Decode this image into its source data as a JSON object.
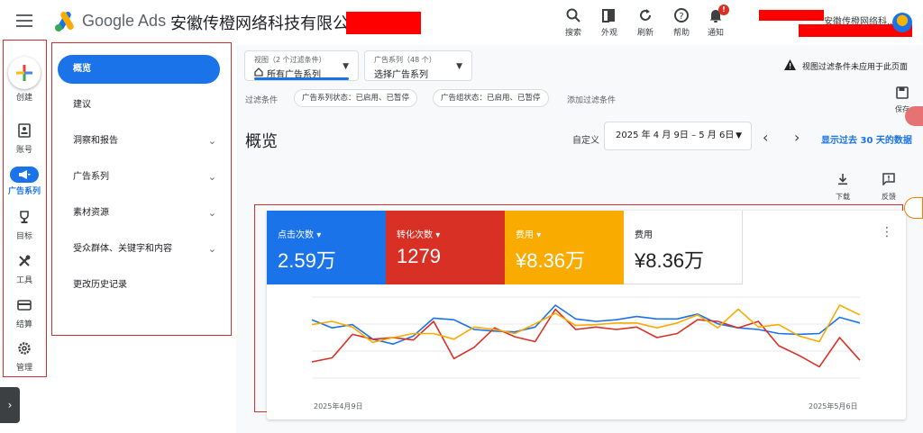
{
  "header": {
    "brand": "Google Ads",
    "company": "安徽传橙网络科技有限公司",
    "account_name": "安徽传橙网络科...",
    "buttons": [
      {
        "label": "搜索",
        "icon": "search-icon"
      },
      {
        "label": "外观",
        "icon": "appearance-icon"
      },
      {
        "label": "刷新",
        "icon": "refresh-icon"
      },
      {
        "label": "帮助",
        "icon": "help-icon"
      },
      {
        "label": "通知",
        "icon": "bell-icon"
      }
    ],
    "notification_badge": "!"
  },
  "rail": {
    "items": [
      {
        "label": "创建",
        "icon": "plus-icon"
      },
      {
        "label": "账号",
        "icon": "account-icon"
      },
      {
        "label": "广告系列",
        "icon": "megaphone-icon"
      },
      {
        "label": "目标",
        "icon": "trophy-icon"
      },
      {
        "label": "工具",
        "icon": "tools-icon"
      },
      {
        "label": "结算",
        "icon": "billing-card-icon"
      },
      {
        "label": "管理",
        "icon": "gear-icon"
      }
    ]
  },
  "nav": {
    "items": [
      {
        "label": "概览"
      },
      {
        "label": "建议"
      },
      {
        "label": "洞察和报告"
      },
      {
        "label": "广告系列"
      },
      {
        "label": "素材资源"
      },
      {
        "label": "受众群体、关键字和内容"
      },
      {
        "label": "更改历史记录"
      }
    ]
  },
  "toolbar": {
    "view_small": "视图（2 个过滤条件）",
    "view_value": "所有广告系列",
    "campaign_small": "广告系列（48 个）",
    "campaign_value": "选择广告系列",
    "warning": "视图过滤条件未应用于此页面",
    "filter_label": "过滤条件",
    "chips": [
      "广告系列状态：已启用、已暂停",
      "广告组状态：已启用、已暂停"
    ],
    "add_filter": "添加过滤条件",
    "save": "保存"
  },
  "page": {
    "title": "概览",
    "custom_label": "自定义",
    "date_range": "2025 年 4 月 9日 – 5 月 6日",
    "show_last": "显示过去 30 天的数据",
    "download": "下载",
    "feedback": "反馈"
  },
  "metrics": [
    {
      "label": "点击次数",
      "value": "2.59万",
      "color": "#1a73e8"
    },
    {
      "label": "转化次数",
      "value": "1279",
      "color": "#d93025"
    },
    {
      "label": "费用",
      "value": "¥8.36万",
      "color": "#f9ab00"
    },
    {
      "label": "费用",
      "value": "¥8.36万",
      "color": "#ffffff"
    }
  ],
  "chart_data": {
    "type": "line",
    "x": [
      "2025年4月9日",
      "",
      "",
      "",
      "",
      "",
      "",
      "",
      "",
      "",
      "",
      "",
      "",
      "",
      "",
      "",
      "",
      "",
      "",
      "",
      "",
      "",
      "",
      "",
      "",
      "",
      "",
      "2025年5月6日"
    ],
    "xlabel": "",
    "ylabel": "",
    "series": [
      {
        "name": "点击次数",
        "color": "#1a73e8",
        "values": [
          0.72,
          0.62,
          0.66,
          0.48,
          0.42,
          0.52,
          0.74,
          0.72,
          0.6,
          0.58,
          0.57,
          0.63,
          0.9,
          0.73,
          0.7,
          0.72,
          0.76,
          0.73,
          0.73,
          0.79,
          0.67,
          0.62,
          0.6,
          0.55,
          0.54,
          0.55,
          0.75,
          0.68
        ]
      },
      {
        "name": "转化次数",
        "color": "#d93025",
        "values": [
          0.2,
          0.25,
          0.54,
          0.48,
          0.5,
          0.47,
          0.7,
          0.24,
          0.38,
          0.62,
          0.51,
          0.45,
          0.85,
          0.6,
          0.63,
          0.6,
          0.63,
          0.5,
          0.55,
          0.72,
          0.7,
          0.62,
          0.7,
          0.4,
          0.28,
          0.14,
          0.5,
          0.22
        ]
      },
      {
        "name": "费用",
        "color": "#f9ab00",
        "values": [
          0.66,
          0.7,
          0.63,
          0.44,
          0.5,
          0.55,
          0.55,
          0.48,
          0.63,
          0.6,
          0.55,
          0.67,
          0.8,
          0.65,
          0.66,
          0.68,
          0.68,
          0.62,
          0.68,
          0.78,
          0.62,
          0.85,
          0.63,
          0.66,
          0.52,
          0.45,
          0.9,
          0.78
        ]
      }
    ],
    "grid": true
  }
}
